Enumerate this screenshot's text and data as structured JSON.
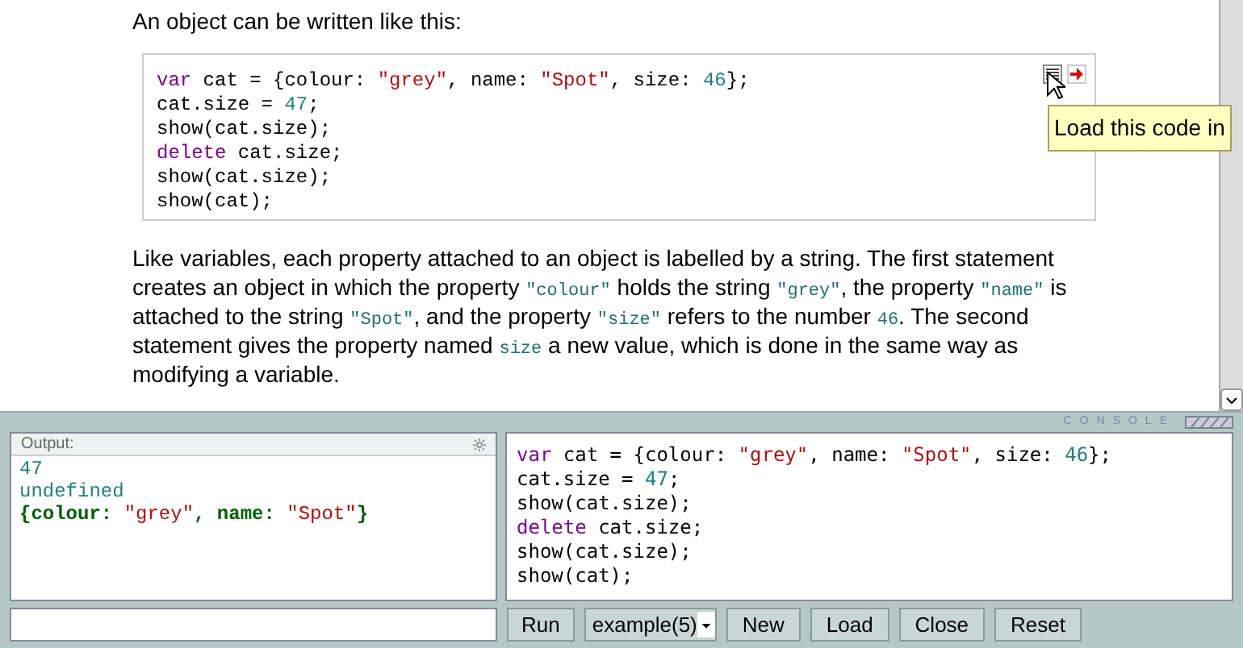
{
  "intro": "An object can be written like this:",
  "code_block": {
    "lines": [
      [
        {
          "kind": "kw",
          "text": "var"
        },
        {
          "kind": "plain",
          "text": " cat = {colour: "
        },
        {
          "kind": "str",
          "text": "\"grey\""
        },
        {
          "kind": "plain",
          "text": ", name: "
        },
        {
          "kind": "str",
          "text": "\"Spot\""
        },
        {
          "kind": "plain",
          "text": ", size: "
        },
        {
          "kind": "num",
          "text": "46"
        },
        {
          "kind": "plain",
          "text": "};"
        }
      ],
      [
        {
          "kind": "plain",
          "text": "cat.size = "
        },
        {
          "kind": "num",
          "text": "47"
        },
        {
          "kind": "plain",
          "text": ";"
        }
      ],
      [
        {
          "kind": "plain",
          "text": "show(cat.size);"
        }
      ],
      [
        {
          "kind": "kw",
          "text": "delete"
        },
        {
          "kind": "plain",
          "text": " cat.size;"
        }
      ],
      [
        {
          "kind": "plain",
          "text": "show(cat.size);"
        }
      ],
      [
        {
          "kind": "plain",
          "text": "show(cat);"
        }
      ]
    ],
    "tooltip": "Load this code in"
  },
  "paragraph": [
    {
      "kind": "text",
      "text": "Like variables, each property attached to an object is labelled by a string. The first statement creates an object in which the property "
    },
    {
      "kind": "code",
      "text": "\"colour\""
    },
    {
      "kind": "text",
      "text": " holds the string "
    },
    {
      "kind": "code",
      "text": "\"grey\""
    },
    {
      "kind": "text",
      "text": ", the property "
    },
    {
      "kind": "code",
      "text": "\"name\""
    },
    {
      "kind": "text",
      "text": " is attached to the string "
    },
    {
      "kind": "code",
      "text": "\"Spot\""
    },
    {
      "kind": "text",
      "text": ", and the property "
    },
    {
      "kind": "code",
      "text": "\"size\""
    },
    {
      "kind": "text",
      "text": " refers to the number "
    },
    {
      "kind": "code",
      "text": "46"
    },
    {
      "kind": "text",
      "text": ". The second statement gives the property named "
    },
    {
      "kind": "code",
      "text": "size"
    },
    {
      "kind": "text",
      "text": " a new value, which is done in the same way as modifying a variable."
    }
  ],
  "console": {
    "label": "CONSOLE",
    "output_title": "Output:",
    "output": [
      [
        {
          "kind": "num",
          "text": "47"
        }
      ],
      [
        {
          "kind": "num",
          "text": "undefined"
        }
      ],
      [
        {
          "kind": "obj",
          "text": "{colour: "
        },
        {
          "kind": "str",
          "text": "\"grey\""
        },
        {
          "kind": "obj",
          "text": ", name: "
        },
        {
          "kind": "str",
          "text": "\"Spot\""
        },
        {
          "kind": "obj",
          "text": "}"
        }
      ]
    ],
    "editor": [
      [
        {
          "kind": "kw",
          "text": "var"
        },
        {
          "kind": "plain",
          "text": " cat = {colour: "
        },
        {
          "kind": "str",
          "text": "\"grey\""
        },
        {
          "kind": "plain",
          "text": ", name: "
        },
        {
          "kind": "str",
          "text": "\"Spot\""
        },
        {
          "kind": "plain",
          "text": ", size: "
        },
        {
          "kind": "num",
          "text": "46"
        },
        {
          "kind": "plain",
          "text": "};"
        }
      ],
      [
        {
          "kind": "plain",
          "text": "cat.size = "
        },
        {
          "kind": "num",
          "text": "47"
        },
        {
          "kind": "plain",
          "text": ";"
        }
      ],
      [
        {
          "kind": "plain",
          "text": "show(cat.size);"
        }
      ],
      [
        {
          "kind": "kw",
          "text": "delete"
        },
        {
          "kind": "plain",
          "text": " cat.size;"
        }
      ],
      [
        {
          "kind": "plain",
          "text": "show(cat.size);"
        }
      ],
      [
        {
          "kind": "plain",
          "text": "show(cat);"
        }
      ]
    ],
    "buttons_left": [
      "Run"
    ],
    "example_select": "example(5)",
    "buttons_right": [
      "New",
      "Load",
      "Close",
      "Reset"
    ]
  }
}
